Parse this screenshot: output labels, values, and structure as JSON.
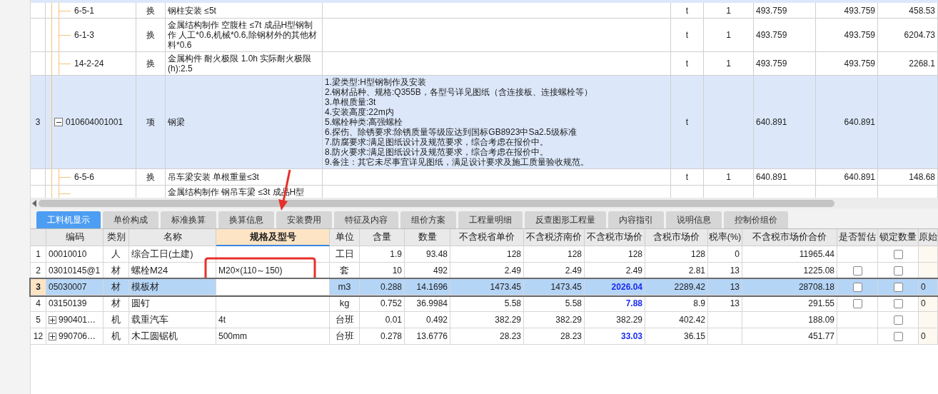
{
  "top_grid": {
    "rows": [
      {
        "num": "",
        "code": "6-5-1",
        "kind": "sub",
        "type": "换",
        "name": "钢柱安装 ≤5t",
        "features": [],
        "unit": "t",
        "qty": "1",
        "c8": "493.759",
        "c9": "493.759",
        "c10": "458.53",
        "selected": false
      },
      {
        "num": "",
        "code": "6-1-3",
        "kind": "sub",
        "type": "换",
        "name": "金属结构制作 空腹柱 ≤7t  成品H型钢制作 人工*0.6,机械*0.6,除钢材外的其他材料*0.6",
        "features": [],
        "unit": "t",
        "qty": "1",
        "c8": "493.759",
        "c9": "493.759",
        "c10": "6204.73",
        "selected": false
      },
      {
        "num": "",
        "code": "14-2-24",
        "kind": "sub",
        "type": "换",
        "name": "金属构件 耐火极限 1.0h  实际耐火极限(h):2.5",
        "features": [],
        "unit": "t",
        "qty": "1",
        "c8": "493.759",
        "c9": "493.759",
        "c10": "2268.1",
        "selected": false
      },
      {
        "num": "3",
        "code": "010604001001",
        "kind": "item",
        "expanded": true,
        "type": "项",
        "name": "钢梁",
        "features": [
          "1.梁类型:H型钢制作及安装",
          "2.钢材品种、规格:Q355B，各型号详见图纸（含连接板、连接螺栓等）",
          "3.单根质量:3t",
          "4.安装高度:22m内",
          "5.螺栓种类:高强螺栓",
          "6.探伤、除锈要求:除锈质量等级应达到国标GB8923中Sa2.5级标准",
          "7.防腐要求:满足图纸设计及规范要求，综合考虑在报价中。",
          "8.防火要求:满足图纸设计及规范要求，综合考虑在报价中。",
          "9.备注：其它未尽事宜详见图纸，满足设计要求及施工质量验收规范。"
        ],
        "unit": "t",
        "qty": "",
        "c8": "640.891",
        "c9": "640.891",
        "c10": "",
        "selected": true
      },
      {
        "num": "",
        "code": "6-5-6",
        "kind": "sub",
        "type": "换",
        "name": "吊车梁安装 单根重量≤3t",
        "features": [],
        "unit": "t",
        "qty": "1",
        "c8": "640.891",
        "c9": "640.891",
        "c10": "148.68",
        "selected": false
      },
      {
        "num": "",
        "code": "",
        "kind": "sub",
        "type": "",
        "name": "金属结构制作 钢吊车梁 ≤3t  成品H型",
        "features": [],
        "unit": "",
        "qty": "",
        "c8": "",
        "c9": "",
        "c10": "",
        "selected": false
      }
    ]
  },
  "tabs": [
    {
      "label": "工料机显示",
      "selected": true
    },
    {
      "label": "单价构成",
      "selected": false
    },
    {
      "label": "标准换算",
      "selected": false
    },
    {
      "label": "换算信息",
      "selected": false
    },
    {
      "label": "安装费用",
      "selected": false
    },
    {
      "label": "特征及内容",
      "selected": false
    },
    {
      "label": "组价方案",
      "selected": false
    },
    {
      "label": "工程量明细",
      "selected": false
    },
    {
      "label": "反查图形工程量",
      "selected": false
    },
    {
      "label": "内容指引",
      "selected": false
    },
    {
      "label": "说明信息",
      "selected": false
    },
    {
      "label": "控制价组价",
      "selected": false
    }
  ],
  "bottom_grid": {
    "columns": [
      {
        "selected": false
      },
      {
        "label": "编码",
        "selected": false
      },
      {
        "label": "类别",
        "selected": false
      },
      {
        "label": "名称",
        "selected": false
      },
      {
        "label": "规格及型号",
        "selected": true
      },
      {
        "label": "单位",
        "selected": false
      },
      {
        "label": "含量",
        "selected": false
      },
      {
        "label": "数量",
        "selected": false
      },
      {
        "label": "不含税省单价",
        "selected": false
      },
      {
        "label": "不含税济南价",
        "selected": false
      },
      {
        "label": "不含税市场价",
        "selected": false
      },
      {
        "label": "含税市场价",
        "selected": false
      },
      {
        "label": "税率(%)",
        "selected": false
      },
      {
        "label": "不含税市场价合价",
        "selected": false
      },
      {
        "label": "是否暂估",
        "selected": false
      },
      {
        "label": "锁定数量",
        "selected": false
      },
      {
        "label": "原始",
        "selected": false
      }
    ],
    "rows": [
      {
        "num": "1",
        "code": "00010010",
        "type": "人",
        "name": "综合工日(土建)",
        "spec": "",
        "unit": "工日",
        "amount": "1.9",
        "qty": "93.48",
        "prov": "128",
        "jinan": "128",
        "market": "128",
        "market_changed": false,
        "taxed": "128",
        "rate": "0",
        "total": "11965.44",
        "locked": false,
        "orig": "",
        "selected": false
      },
      {
        "num": "2",
        "code": "03010145@1",
        "type": "材",
        "name": "螺栓M24",
        "spec": "M20×(110～150)",
        "unit": "套",
        "amount": "10",
        "qty": "492",
        "prov": "2.49",
        "jinan": "2.49",
        "market": "2.49",
        "market_changed": false,
        "taxed": "2.81",
        "rate": "13",
        "total": "1225.08",
        "estimate": false,
        "locked": false,
        "orig": "",
        "selected": false
      },
      {
        "num": "3",
        "code": "05030007",
        "type": "材",
        "name": "模板材",
        "spec": "",
        "unit": "m3",
        "amount": "0.288",
        "qty": "14.1696",
        "prov": "1473.45",
        "jinan": "1473.45",
        "market": "2026.04",
        "market_changed": true,
        "taxed": "2289.42",
        "rate": "13",
        "total": "28708.18",
        "estimate": false,
        "locked": false,
        "orig": "0",
        "selected": true
      },
      {
        "num": "4",
        "code": "03150139",
        "type": "材",
        "name": "圆钉",
        "spec": "",
        "unit": "kg",
        "amount": "0.752",
        "qty": "36.9984",
        "prov": "5.58",
        "jinan": "5.58",
        "market": "7.88",
        "market_changed": true,
        "taxed": "8.9",
        "rate": "13",
        "total": "291.55",
        "estimate": false,
        "locked": false,
        "orig": "0",
        "selected": false
      },
      {
        "num": "5",
        "code": "990401…",
        "expanded": false,
        "type": "机",
        "name": "载重汽车",
        "spec": "4t",
        "unit": "台班",
        "amount": "0.01",
        "qty": "0.492",
        "prov": "382.29",
        "jinan": "382.29",
        "market": "382.29",
        "market_changed": false,
        "taxed": "402.42",
        "rate": "",
        "total": "188.09",
        "locked": false,
        "orig": "",
        "selected": false
      },
      {
        "num": "12",
        "code": "990706…",
        "expanded": false,
        "type": "机",
        "name": "木工圆锯机",
        "spec": "500mm",
        "unit": "台班",
        "amount": "0.278",
        "qty": "13.6776",
        "prov": "28.23",
        "jinan": "28.23",
        "market": "33.03",
        "market_changed": true,
        "taxed": "36.15",
        "rate": "",
        "total": "451.77",
        "locked": false,
        "orig": "0",
        "selected": false
      }
    ]
  }
}
